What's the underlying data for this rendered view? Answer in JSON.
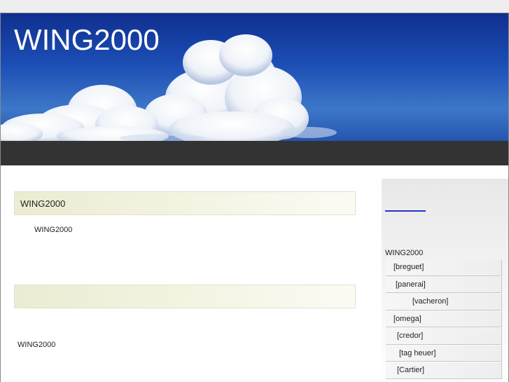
{
  "header": {
    "site_title": "WING2000"
  },
  "main": {
    "sections": [
      {
        "heading": "WING2000",
        "body": "WING2000"
      },
      {
        "heading": "",
        "body": "WING2000"
      }
    ]
  },
  "sidebar": {
    "link_text": "",
    "heading": "WING2000",
    "items": [
      {
        "label": "[breguet]"
      },
      {
        "label": "[panerai]"
      },
      {
        "label": "[vacheron]"
      },
      {
        "label": "[omega]"
      },
      {
        "label": "[credor]"
      },
      {
        "label": "[tag heuer]"
      },
      {
        "label": "[Cartier]"
      }
    ]
  },
  "colors": {
    "banner_sky": "#1c4eb5",
    "nav_bar": "#333333",
    "section_head_bg": "#ececd2",
    "sidebar_link": "#2233cc"
  }
}
